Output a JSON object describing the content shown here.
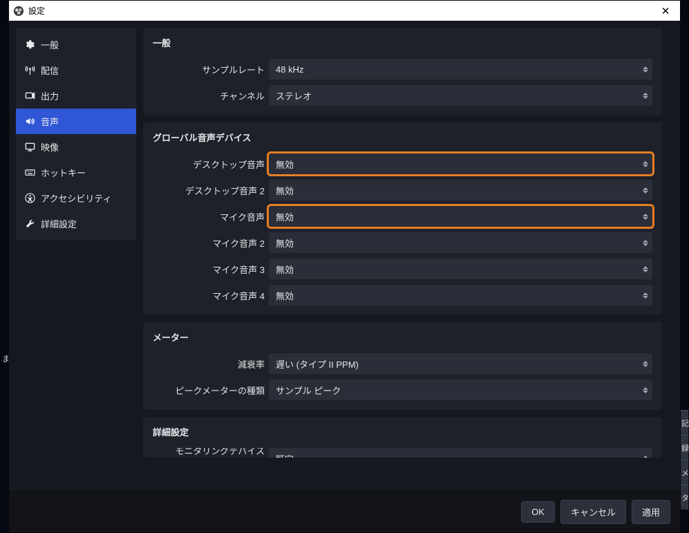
{
  "window": {
    "title": "設定"
  },
  "sidebar": {
    "items": [
      {
        "label": "一般"
      },
      {
        "label": "配信"
      },
      {
        "label": "出力"
      },
      {
        "label": "音声"
      },
      {
        "label": "映像"
      },
      {
        "label": "ホットキー"
      },
      {
        "label": "アクセシビリティ"
      },
      {
        "label": "詳細設定"
      }
    ]
  },
  "panels": {
    "general": {
      "title": "一般",
      "sample_rate": {
        "label": "サンプルレート",
        "value": "48 kHz"
      },
      "channels": {
        "label": "チャンネル",
        "value": "ステレオ"
      }
    },
    "devices": {
      "title": "グローバル音声デバイス",
      "desktop1": {
        "label": "デスクトップ音声",
        "value": "無効"
      },
      "desktop2": {
        "label": "デスクトップ音声 2",
        "value": "無効"
      },
      "mic1": {
        "label": "マイク音声",
        "value": "無効"
      },
      "mic2": {
        "label": "マイク音声 2",
        "value": "無効"
      },
      "mic3": {
        "label": "マイク音声 3",
        "value": "無効"
      },
      "mic4": {
        "label": "マイク音声 4",
        "value": "無効"
      }
    },
    "meter": {
      "title": "メーター",
      "decay": {
        "label": "減衰率",
        "value": "遅い (タイプ II PPM)"
      },
      "peak": {
        "label": "ピークメーターの種類",
        "value": "サンプル ピーク"
      }
    },
    "advanced": {
      "title": "詳細設定",
      "monitor": {
        "label": "モニタリングデバイス",
        "value": "既定"
      }
    }
  },
  "footer": {
    "ok": "OK",
    "cancel": "キャンセル",
    "apply": "適用"
  },
  "bg_peek": [
    "記",
    "録",
    "メ",
    "タ"
  ],
  "bg_peek_left": "ま"
}
